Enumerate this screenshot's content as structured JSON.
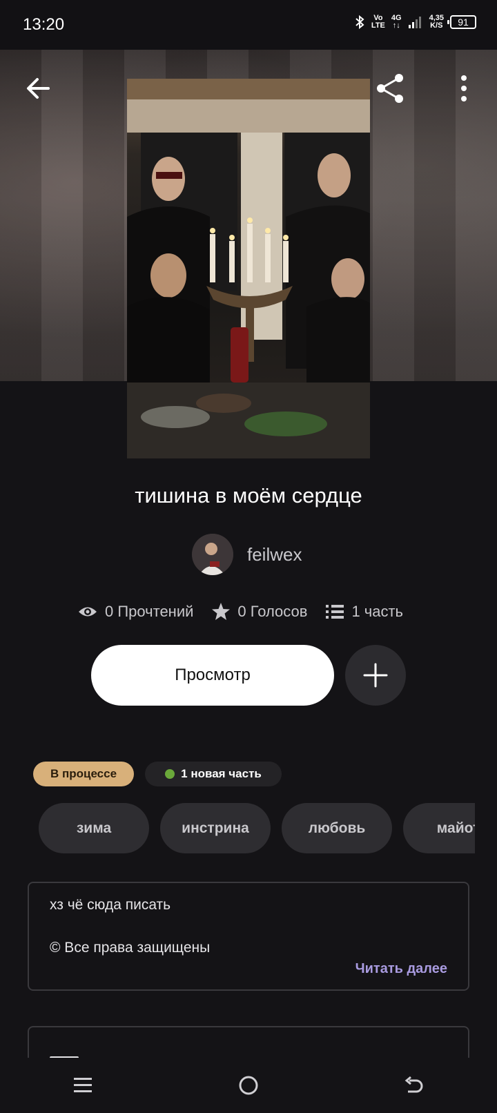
{
  "status_bar": {
    "time": "13:20",
    "network_vo": "Vo",
    "network_lte": "LTE",
    "network_4g": "4G",
    "speed_value": "4,35",
    "speed_unit": "K/S",
    "battery": "91"
  },
  "story": {
    "title": "тишина в моём сердце",
    "author": "feilwex"
  },
  "stats": {
    "reads": "0 Прочтений",
    "votes": "0 Голосов",
    "parts": "1 часть"
  },
  "actions": {
    "view_label": "Просмотр"
  },
  "badges": {
    "status": "В процессе",
    "new_part": "1 новая часть"
  },
  "tags": [
    "зима",
    "инстрина",
    "любовь",
    "майот"
  ],
  "description": {
    "line1": "хз чё сюда писать",
    "line2": "© Все права защищены",
    "read_more": "Читать далее"
  },
  "colors": {
    "background": "#141316",
    "badge_progress": "#d8b07a",
    "new_dot": "#6aa83a",
    "link": "#a99be0"
  },
  "icons": [
    "arrow-left-icon",
    "share-icon",
    "more-vertical-icon",
    "eye-icon",
    "star-icon",
    "list-icon",
    "plus-icon",
    "menu-icon",
    "home-circle-icon",
    "back-icon"
  ]
}
